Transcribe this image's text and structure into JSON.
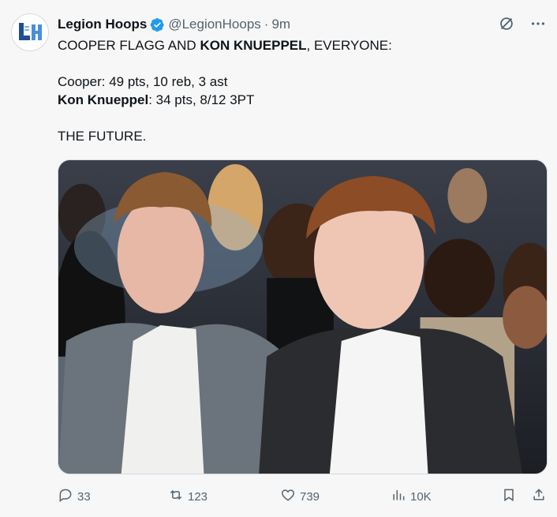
{
  "tweet": {
    "author": {
      "name": "Legion Hoops",
      "handle": "@LegionHoops",
      "separator": "·",
      "time": "9m",
      "avatar_text": "LH",
      "verified_color": "#1d9bf0"
    },
    "text": {
      "line1_a": "COOPER FLAGG AND ",
      "line1_b": "KON KNUEPPEL",
      "line1_c": ", EVERYONE:",
      "line3": "Cooper: 49 pts, 10 reb, 3 ast",
      "line4_name": "Kon Knueppel",
      "line4_rest": ": 34 pts, 8/12 3PT",
      "line6": "THE FUTURE."
    },
    "top_icons": [
      "grok-icon",
      "more-icon"
    ],
    "stats": {
      "replies": "33",
      "reposts": "123",
      "likes": "739",
      "views": "10K"
    }
  },
  "colors": {
    "text_primary": "#0f1419",
    "text_secondary": "#536471",
    "background": "#f7f7f7"
  }
}
